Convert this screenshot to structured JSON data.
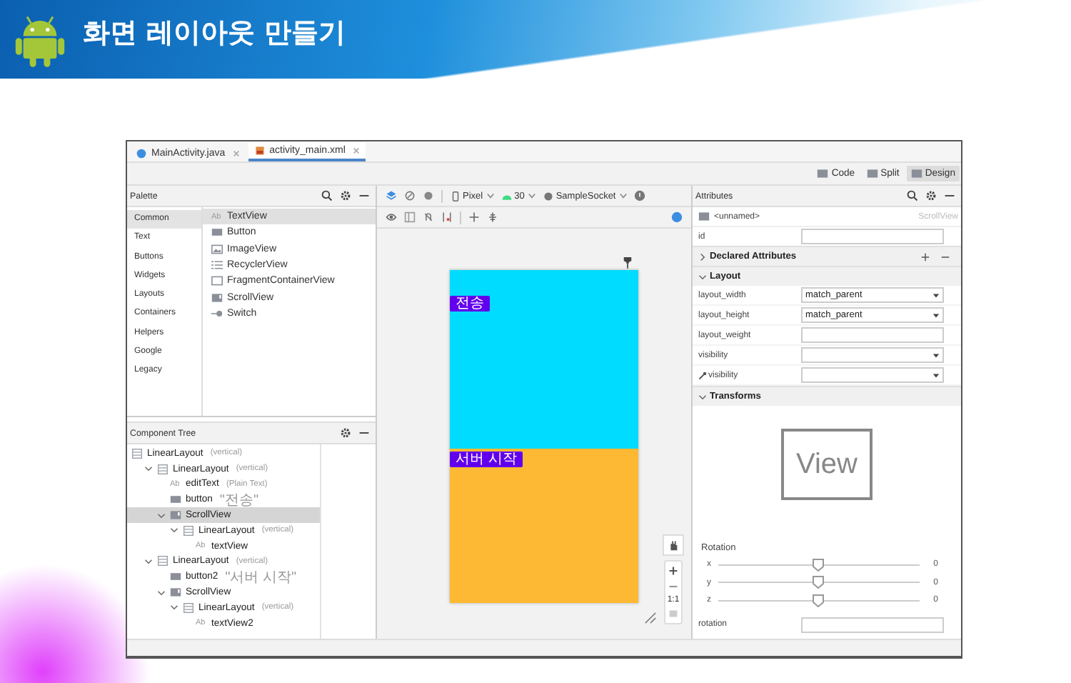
{
  "slide": {
    "title": "화면 레이아웃 만들기"
  },
  "editor_tabs": [
    {
      "label": "MainActivity.java",
      "kind": "java",
      "selected": false
    },
    {
      "label": "activity_main.xml",
      "kind": "xml",
      "selected": true
    }
  ],
  "view_modes": [
    {
      "label": "Code",
      "selected": false
    },
    {
      "label": "Split",
      "selected": false
    },
    {
      "label": "Design",
      "selected": true
    }
  ],
  "palette": {
    "title": "Palette",
    "categories": [
      {
        "label": "Common",
        "selected": true
      },
      {
        "label": "Text",
        "selected": false
      },
      {
        "label": "Buttons",
        "selected": false
      },
      {
        "label": "Widgets",
        "selected": false
      },
      {
        "label": "Layouts",
        "selected": false
      },
      {
        "label": "Containers",
        "selected": false
      },
      {
        "label": "Helpers",
        "selected": false
      },
      {
        "label": "Google",
        "selected": false
      },
      {
        "label": "Legacy",
        "selected": false
      }
    ],
    "items": [
      {
        "label": "TextView",
        "kind": "text",
        "icon_text": "Ab",
        "selected": true
      },
      {
        "label": "Button",
        "kind": "button",
        "selected": false
      },
      {
        "label": "ImageView",
        "kind": "image",
        "selected": false
      },
      {
        "label": "RecyclerView",
        "kind": "list",
        "selected": false
      },
      {
        "label": "FragmentContainerView",
        "kind": "frame",
        "selected": false
      },
      {
        "label": "ScrollView",
        "kind": "scroll",
        "selected": false
      },
      {
        "label": "Switch",
        "kind": "switch",
        "selected": false
      }
    ]
  },
  "component_tree": {
    "title": "Component Tree",
    "nodes": [
      {
        "label": "LinearLayout",
        "hint": "(vertical)",
        "kind": "layout",
        "selected": false,
        "children": [
          {
            "label": "LinearLayout",
            "hint": "(vertical)",
            "kind": "layout",
            "expanded": true,
            "selected": false,
            "children": [
              {
                "label": "editText",
                "hint": "(Plain Text)",
                "kind": "text",
                "icon_text": "Ab",
                "selected": false
              },
              {
                "label": "button",
                "hint": "\"전송\"",
                "kind": "button",
                "selected": false
              },
              {
                "label": "ScrollView",
                "kind": "scroll",
                "expanded": true,
                "selected": true,
                "children": [
                  {
                    "label": "LinearLayout",
                    "hint": "(vertical)",
                    "kind": "layout",
                    "expanded": true,
                    "selected": false,
                    "children": [
                      {
                        "label": "textView",
                        "kind": "text",
                        "icon_text": "Ab",
                        "selected": false
                      }
                    ]
                  }
                ]
              }
            ]
          },
          {
            "label": "LinearLayout",
            "hint": "(vertical)",
            "kind": "layout",
            "expanded": true,
            "selected": false,
            "children": [
              {
                "label": "button2",
                "hint": "\"서버 시작\"",
                "kind": "button",
                "selected": false
              },
              {
                "label": "ScrollView",
                "kind": "scroll",
                "expanded": true,
                "selected": false,
                "children": [
                  {
                    "label": "LinearLayout",
                    "hint": "(vertical)",
                    "kind": "layout",
                    "expanded": true,
                    "selected": false,
                    "children": [
                      {
                        "label": "textView2",
                        "kind": "text",
                        "icon_text": "Ab",
                        "selected": false
                      }
                    ]
                  }
                ]
              }
            ]
          }
        ]
      }
    ]
  },
  "design_toolbar": {
    "device": "Pixel",
    "api_level": "30",
    "theme": "SampleSocket"
  },
  "preview": {
    "sections": [
      {
        "button": "전송",
        "color": "#00dcff"
      },
      {
        "button": "서버 시작",
        "color": "#fdb933"
      }
    ]
  },
  "zoom_controls": {
    "ratio": "1:1"
  },
  "attributes": {
    "title": "Attributes",
    "component": "<unnamed>",
    "component_type": "ScrollView",
    "id_label": "id",
    "declared": {
      "title": "Declared Attributes",
      "expanded": false
    },
    "layout": {
      "title": "Layout",
      "expanded": true,
      "rows": [
        {
          "name": "layout_width",
          "value": "match_parent",
          "kind": "dropdown",
          "tools": false
        },
        {
          "name": "layout_height",
          "value": "match_parent",
          "kind": "dropdown",
          "tools": false
        },
        {
          "name": "layout_weight",
          "kind": "text",
          "tools": false
        },
        {
          "name": "visibility",
          "kind": "dropdown",
          "tools": false
        },
        {
          "name": "visibility",
          "kind": "dropdown",
          "tools": true
        }
      ]
    },
    "transforms": {
      "title": "Transforms",
      "expanded": true,
      "preview": "View",
      "rotation_label": "Rotation",
      "axes": [
        {
          "label": "x",
          "level": 0.5,
          "reading": "0"
        },
        {
          "label": "y",
          "level": 0.5,
          "reading": "0"
        },
        {
          "label": "z",
          "level": 0.5,
          "reading": "0"
        }
      ],
      "next_row": "rotation"
    }
  }
}
